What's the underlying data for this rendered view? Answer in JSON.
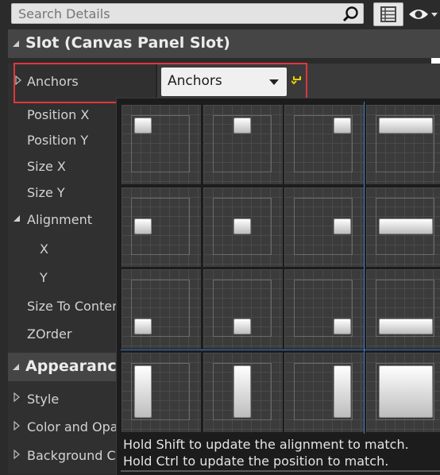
{
  "search": {
    "placeholder": "Search Details"
  },
  "slot_section": {
    "title": "Slot (Canvas Panel Slot)"
  },
  "properties": {
    "anchors": "Anchors",
    "position_x": "Position X",
    "position_y": "Position Y",
    "size_x": "Size X",
    "size_y": "Size Y",
    "alignment": "Alignment",
    "x": "X",
    "y": "Y",
    "size_to_content": "Size To Content",
    "zorder": "ZOrder"
  },
  "anchors_dropdown": {
    "label": "Anchors"
  },
  "appearance_section": {
    "title": "Appearance"
  },
  "appearance_items": {
    "style": "Style",
    "color_and_opacity": "Color and Opac",
    "background_color": "Background Co"
  },
  "hints": {
    "shift": "Hold Shift to update the alignment to match.",
    "ctrl": "Hold Ctrl to update the position to match."
  },
  "colors": {
    "highlight": "#e0373d",
    "guide_line": "#3d7fd0",
    "reset_icon": "#e5d000"
  },
  "icons": [
    "search-icon",
    "grid-view-icon",
    "eye-icon",
    "chevron-down-icon",
    "reset-arrow-icon",
    "triangle-expander-icon"
  ]
}
